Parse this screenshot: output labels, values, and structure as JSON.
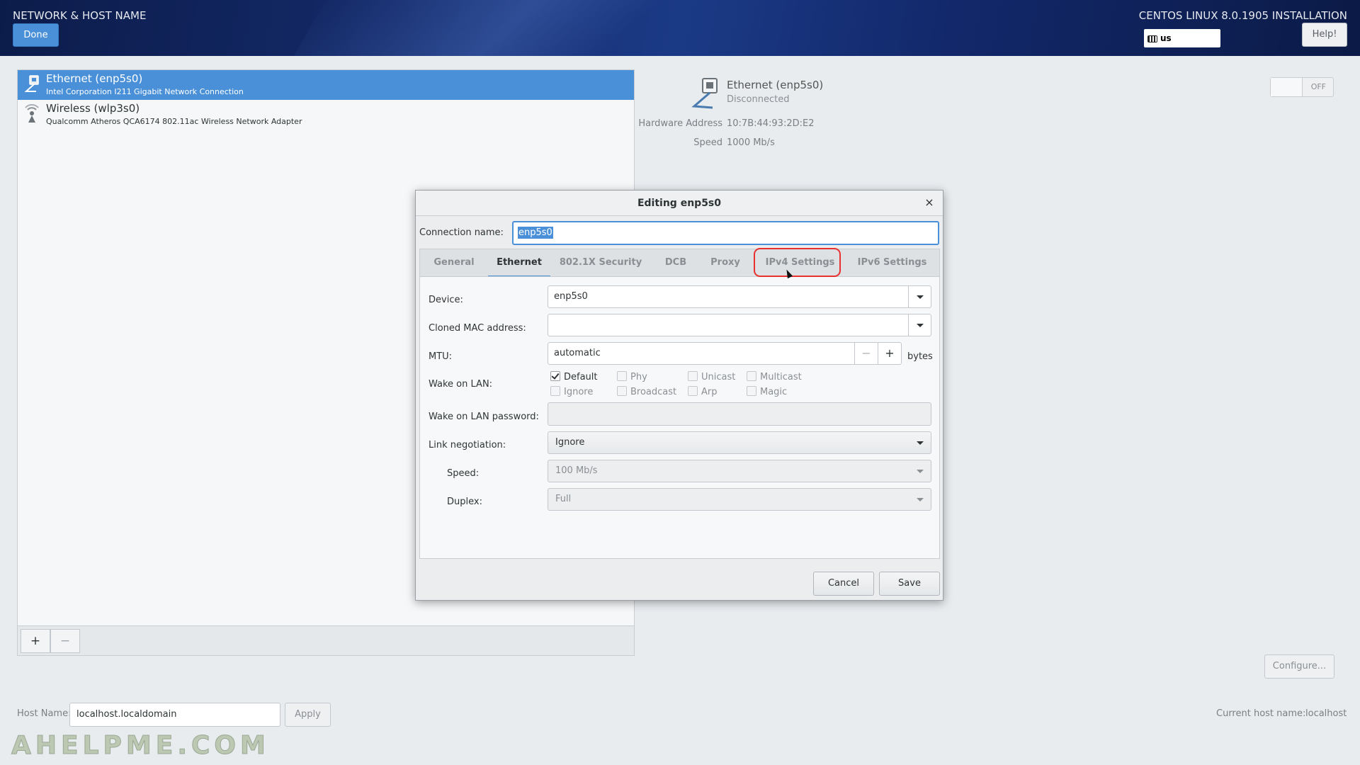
{
  "header": {
    "title": "NETWORK & HOST NAME",
    "done_label": "Done",
    "installer_title": "CENTOS LINUX 8.0.1905 INSTALLATION",
    "keyboard_layout": "us",
    "help_label": "Help!"
  },
  "devices": [
    {
      "name": "Ethernet (enp5s0)",
      "description": "Intel Corporation I211 Gigabit Network Connection",
      "icon": "ethernet-icon",
      "selected": true
    },
    {
      "name": "Wireless (wlp3s0)",
      "description": "Qualcomm Atheros QCA6174 802.11ac Wireless Network Adapter",
      "icon": "wireless-icon",
      "selected": false
    }
  ],
  "list_toolbar": {
    "add_label": "+",
    "remove_label": "−"
  },
  "details": {
    "name": "Ethernet (enp5s0)",
    "status": "Disconnected",
    "hardware_address_label": "Hardware Address",
    "hardware_address_value": "10:7B:44:93:2D:E2",
    "speed_label": "Speed",
    "speed_value": "1000 Mb/s",
    "toggle_label": "OFF",
    "configure_label": "Configure..."
  },
  "host": {
    "label": "Host Name:",
    "value": "localhost.localdomain",
    "apply_label": "Apply",
    "current_label": "Current host name:",
    "current_value": "localhost"
  },
  "watermark": "AHELPME.COM",
  "dialog": {
    "title": "Editing enp5s0",
    "close_label": "×",
    "connection_name_label": "Connection name:",
    "connection_name_value": "enp5s0",
    "tabs": [
      {
        "label": "General",
        "active": false
      },
      {
        "label": "Ethernet",
        "active": true
      },
      {
        "label": "802.1X Security",
        "active": false
      },
      {
        "label": "DCB",
        "active": false
      },
      {
        "label": "Proxy",
        "active": false
      },
      {
        "label": "IPv4 Settings",
        "active": false,
        "highlighted": true
      },
      {
        "label": "IPv6 Settings",
        "active": false
      }
    ],
    "ethernet": {
      "device_label": "Device:",
      "device_value": "enp5s0",
      "cloned_mac_label": "Cloned MAC address:",
      "cloned_mac_value": "",
      "mtu_label": "MTU:",
      "mtu_value": "automatic",
      "mtu_unit": "bytes",
      "mtu_minus": "−",
      "mtu_plus": "+",
      "wol_label": "Wake on LAN:",
      "wol_options": [
        {
          "label": "Default",
          "checked": true,
          "enabled": true
        },
        {
          "label": "Phy",
          "checked": false,
          "enabled": false
        },
        {
          "label": "Unicast",
          "checked": false,
          "enabled": false
        },
        {
          "label": "Multicast",
          "checked": false,
          "enabled": false
        },
        {
          "label": "Ignore",
          "checked": false,
          "enabled": false
        },
        {
          "label": "Broadcast",
          "checked": false,
          "enabled": false
        },
        {
          "label": "Arp",
          "checked": false,
          "enabled": false
        },
        {
          "label": "Magic",
          "checked": false,
          "enabled": false
        }
      ],
      "wol_password_label": "Wake on LAN password:",
      "link_negotiation_label": "Link negotiation:",
      "link_negotiation_value": "Ignore",
      "speed_label": "Speed:",
      "speed_value": "100 Mb/s",
      "duplex_label": "Duplex:",
      "duplex_value": "Full"
    },
    "cancel_label": "Cancel",
    "save_label": "Save"
  },
  "colors": {
    "accent": "#4a90d9",
    "highlight_ring": "#e8302f",
    "header_bg": "#142a6a"
  }
}
